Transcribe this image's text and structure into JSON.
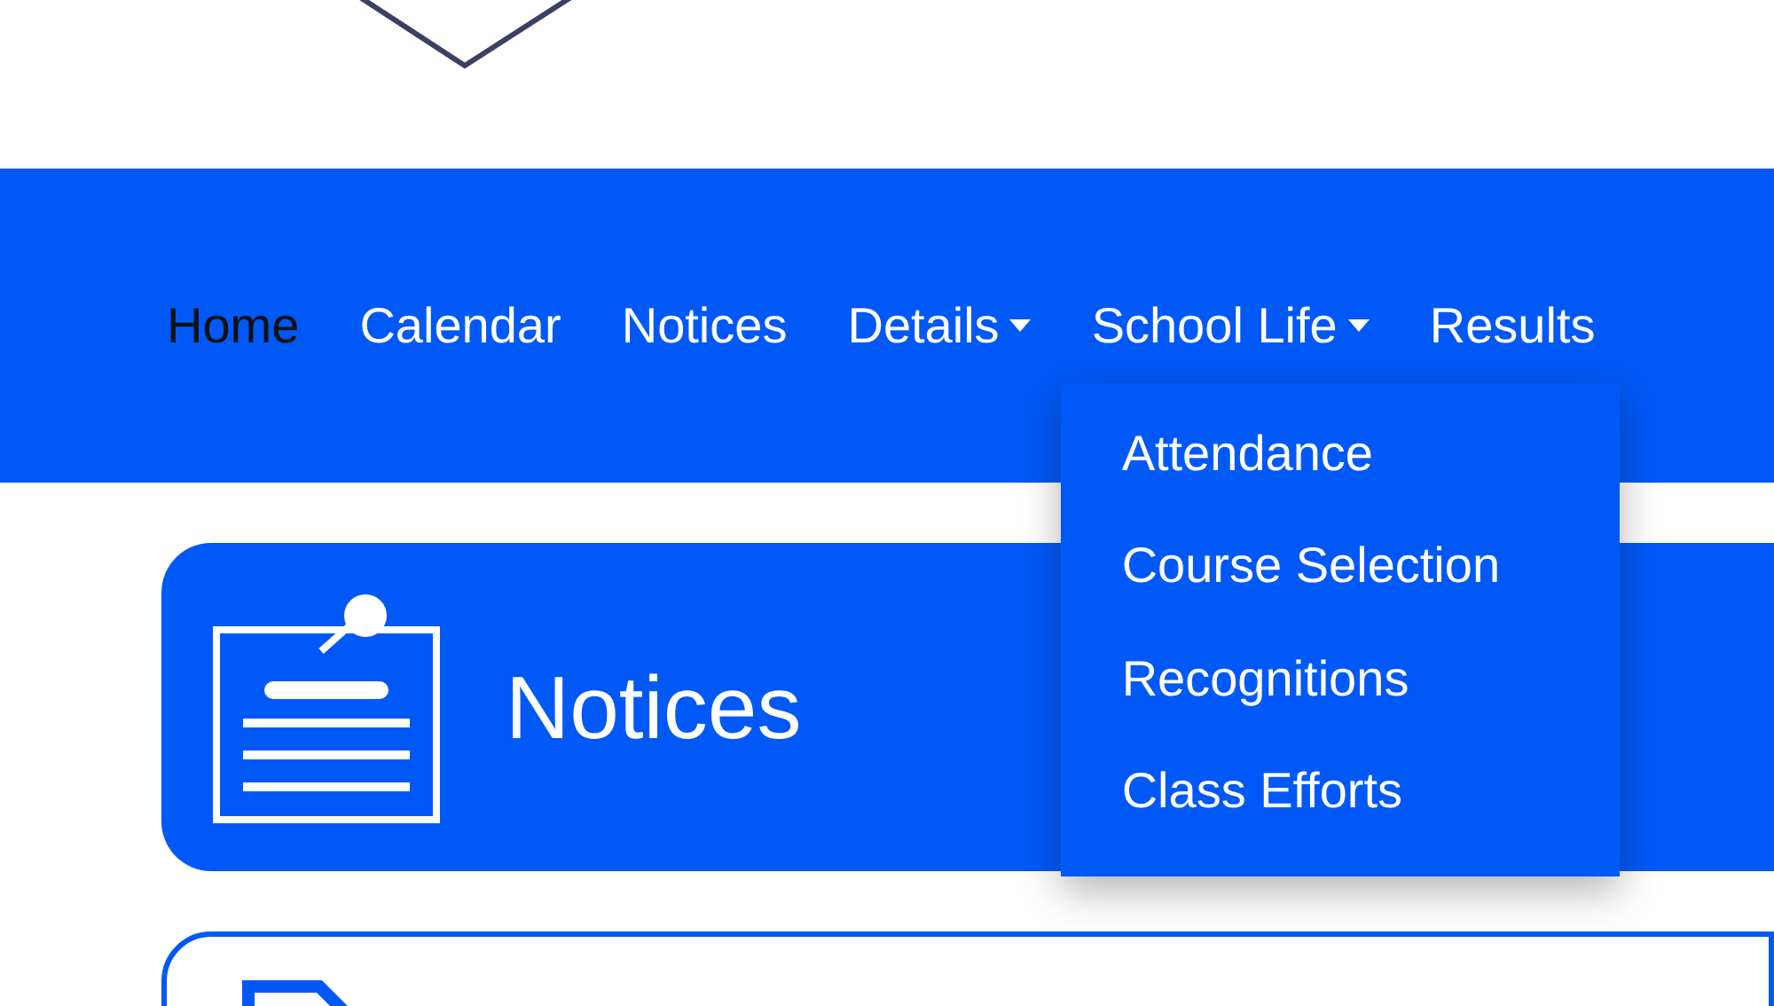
{
  "nav": {
    "items": [
      {
        "label": "Home",
        "kind": "link",
        "selected": true
      },
      {
        "label": "Calendar",
        "kind": "link",
        "selected": false
      },
      {
        "label": "Notices",
        "kind": "link",
        "selected": false
      },
      {
        "label": "Details",
        "kind": "dropdown",
        "selected": false
      },
      {
        "label": "School Life",
        "kind": "dropdown",
        "selected": false,
        "menu": [
          "Attendance",
          "Course Selection",
          "Recognitions",
          "Class Efforts"
        ]
      },
      {
        "label": "Results",
        "kind": "link",
        "selected": false
      }
    ]
  },
  "page_header": {
    "title": "Notices"
  }
}
